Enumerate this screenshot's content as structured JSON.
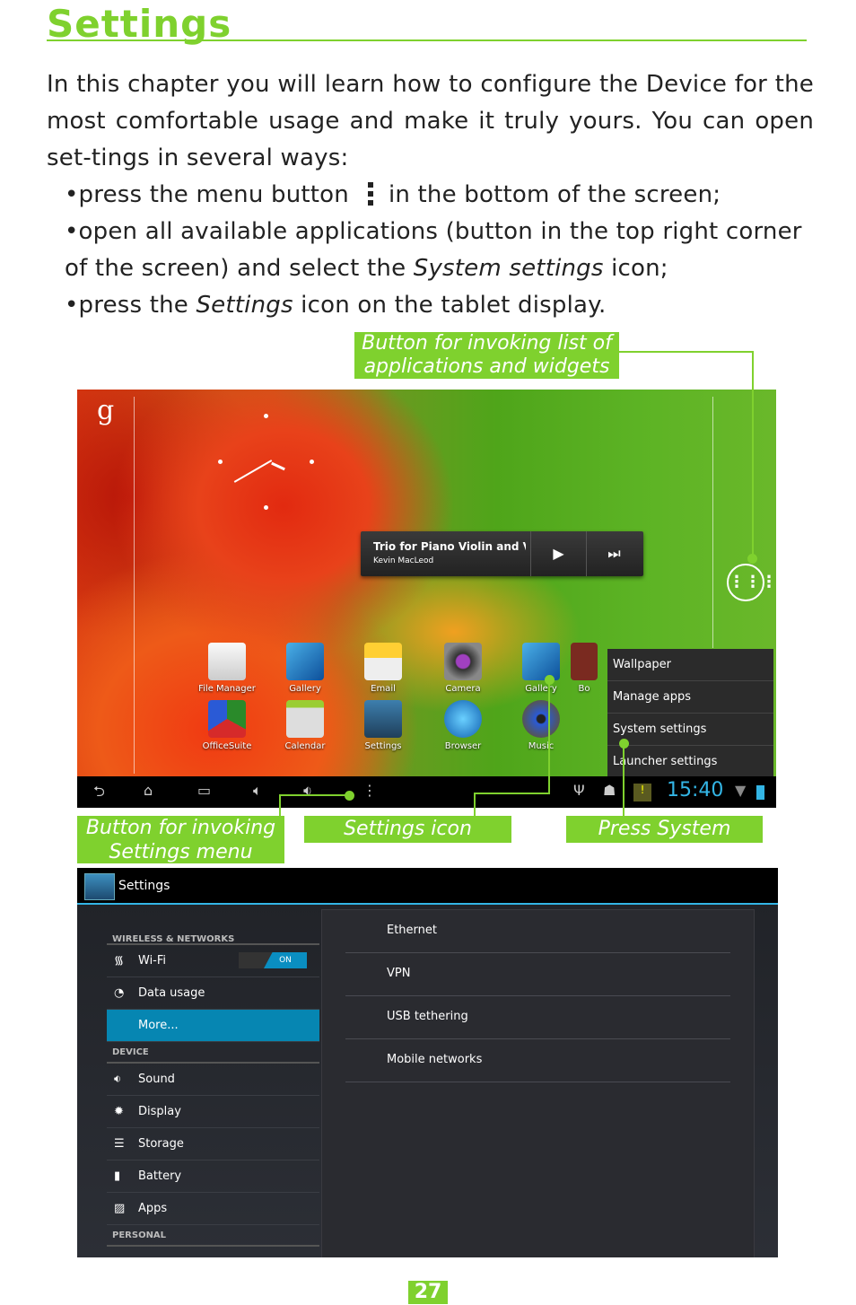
{
  "title": "Settings",
  "intro": {
    "paragraph": "In this chapter you will learn how to configure the Device for the most comfortable usage and make it truly yours. You can open set-tings in several ways:",
    "bullets": [
      {
        "before": "press the menu button",
        "icon": "menu-dots-icon",
        "after": "in the bottom of the screen;"
      },
      {
        "before": "open all available applications (button in the top right corner of the screen) and select the ",
        "emph": "System settings",
        "after": " icon;"
      },
      {
        "before": "press the ",
        "emph": "Settings",
        "after": " icon on the tablet display."
      }
    ]
  },
  "callouts": {
    "apps_button": "Button for invoking list of applications and widgets",
    "settings_menu": "Button for invoking Settings menu",
    "settings_icon": "Settings icon",
    "system_settings": "Press System settings"
  },
  "accent_color": "#7fd12e",
  "home_screen": {
    "music_widget": {
      "title": "Trio for Piano Violin and Vi",
      "artist": "Kevin MacLeod",
      "play": "▶",
      "next": "⏭"
    },
    "apps_row1": [
      "File Manager",
      "Gallery",
      "Email",
      "Camera",
      "Gallery",
      "Bo"
    ],
    "apps_row2": [
      "OfficeSuite",
      "Calendar",
      "Settings",
      "Browser",
      "Music"
    ],
    "context_menu": [
      "Wallpaper",
      "Manage apps",
      "System settings",
      "Launcher settings"
    ],
    "clock": "15:40"
  },
  "settings_screen": {
    "title": "Settings",
    "sections": [
      {
        "header": "WIRELESS & NETWORKS",
        "items": [
          {
            "label": "Wi-Fi",
            "icon": "wifi-icon",
            "toggle": "ON"
          },
          {
            "label": "Data usage",
            "icon": "data-usage-icon"
          },
          {
            "label": "More...",
            "selected": true
          }
        ]
      },
      {
        "header": "DEVICE",
        "items": [
          {
            "label": "Sound",
            "icon": "sound-icon"
          },
          {
            "label": "Display",
            "icon": "display-icon"
          },
          {
            "label": "Storage",
            "icon": "storage-icon"
          },
          {
            "label": "Battery",
            "icon": "battery-icon"
          },
          {
            "label": "Apps",
            "icon": "apps-icon"
          }
        ]
      },
      {
        "header": "PERSONAL",
        "items": []
      }
    ],
    "detail_items": [
      "Ethernet",
      "VPN",
      "USB tethering",
      "Mobile networks"
    ]
  },
  "page_number": "27"
}
